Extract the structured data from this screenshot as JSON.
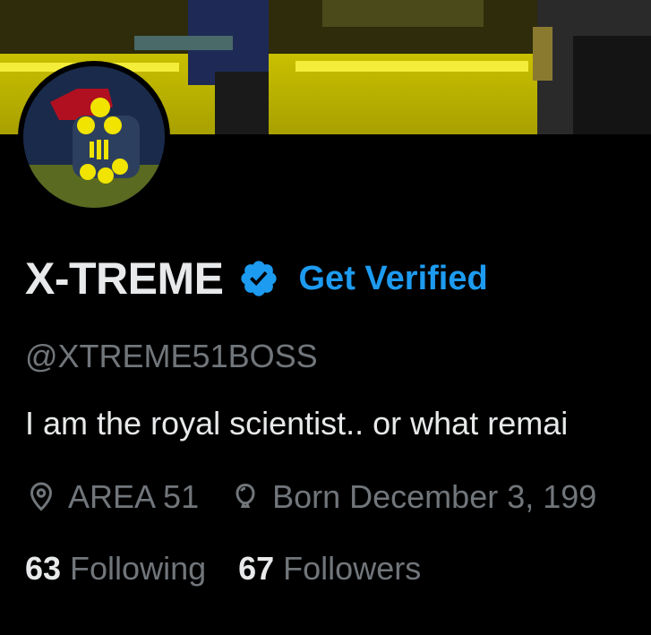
{
  "profile": {
    "display_name": "X-TREME",
    "get_verified_label": "Get Verified",
    "handle": "@XTREME51BOSS",
    "bio": "I am the royal scientist.. or what remai",
    "location": "AREA 51",
    "birthdate": "Born December 3, 199",
    "following_count": "63",
    "following_label": "Following",
    "followers_count": "67",
    "followers_label": "Followers"
  },
  "icons": {
    "verified": "verified-badge-icon",
    "location": "location-pin-icon",
    "birthday": "balloon-icon"
  },
  "colors": {
    "accent": "#1d9bf0",
    "background": "#000000",
    "text_primary": "#e7e9ea",
    "text_secondary": "#71767b"
  }
}
